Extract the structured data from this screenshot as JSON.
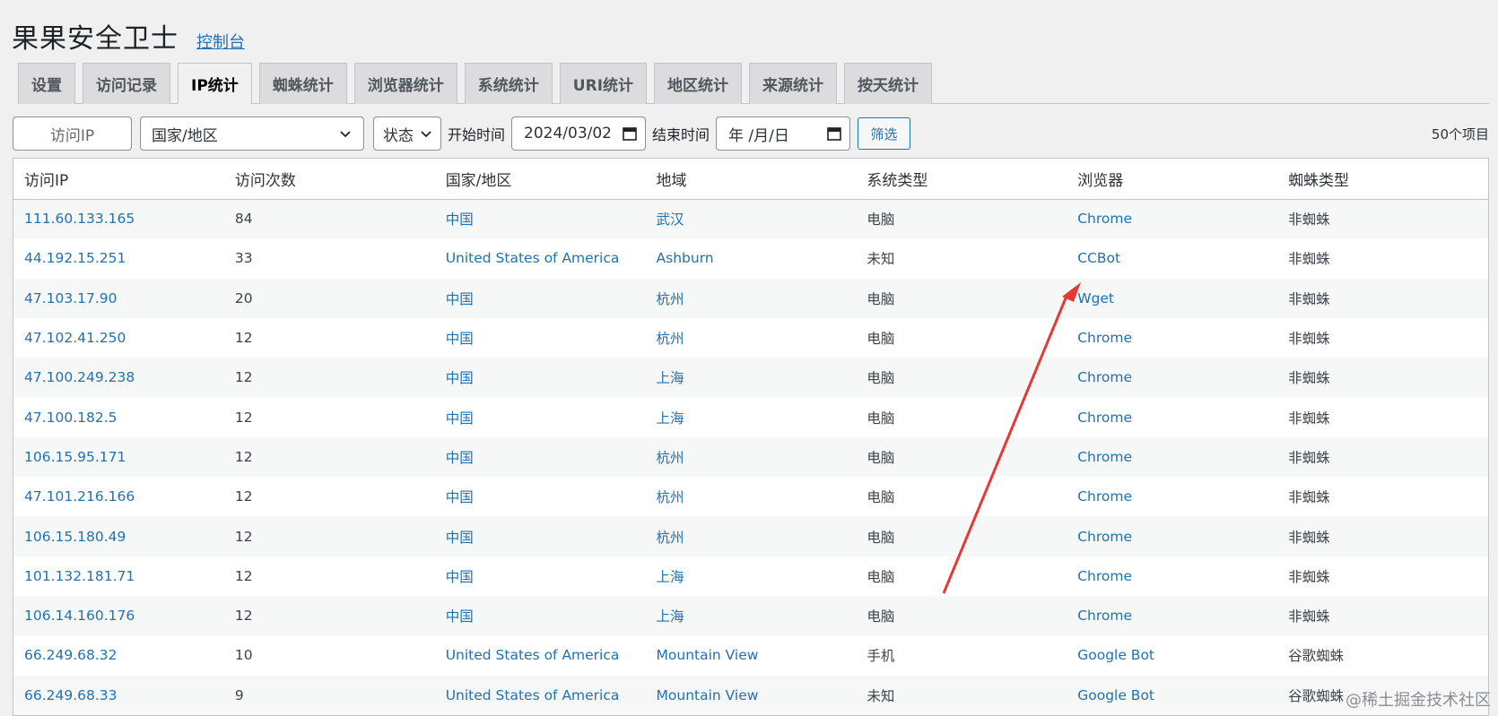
{
  "app": {
    "title": "果果安全卫士",
    "console_link": "控制台"
  },
  "tabs": [
    {
      "label": "设置",
      "active": false
    },
    {
      "label": "访问记录",
      "active": false
    },
    {
      "label": "IP统计",
      "active": true
    },
    {
      "label": "蜘蛛统计",
      "active": false
    },
    {
      "label": "浏览器统计",
      "active": false
    },
    {
      "label": "系统统计",
      "active": false
    },
    {
      "label": "URI统计",
      "active": false
    },
    {
      "label": "地区统计",
      "active": false
    },
    {
      "label": "来源统计",
      "active": false
    },
    {
      "label": "按天统计",
      "active": false
    }
  ],
  "filters": {
    "ip_placeholder": "访问IP",
    "country_value": "国家/地区",
    "status_value": "状态",
    "start_label": "开始时间",
    "start_value": "2024/03/02",
    "end_label": "结束时间",
    "end_value": "年 /月/日",
    "filter_button": "筛选",
    "item_count": "50个项目"
  },
  "table": {
    "headers": [
      "访问IP",
      "访问次数",
      "国家/地区",
      "地域",
      "系统类型",
      "浏览器",
      "蜘蛛类型"
    ],
    "rows": [
      [
        "111.60.133.165",
        "84",
        "中国",
        "武汉",
        "电脑",
        "Chrome",
        "非蜘蛛"
      ],
      [
        "44.192.15.251",
        "33",
        "United States of America",
        "Ashburn",
        "未知",
        "CCBot",
        "非蜘蛛"
      ],
      [
        "47.103.17.90",
        "20",
        "中国",
        "杭州",
        "电脑",
        "Wget",
        "非蜘蛛"
      ],
      [
        "47.102.41.250",
        "12",
        "中国",
        "杭州",
        "电脑",
        "Chrome",
        "非蜘蛛"
      ],
      [
        "47.100.249.238",
        "12",
        "中国",
        "上海",
        "电脑",
        "Chrome",
        "非蜘蛛"
      ],
      [
        "47.100.182.5",
        "12",
        "中国",
        "上海",
        "电脑",
        "Chrome",
        "非蜘蛛"
      ],
      [
        "106.15.95.171",
        "12",
        "中国",
        "杭州",
        "电脑",
        "Chrome",
        "非蜘蛛"
      ],
      [
        "47.101.216.166",
        "12",
        "中国",
        "杭州",
        "电脑",
        "Chrome",
        "非蜘蛛"
      ],
      [
        "106.15.180.49",
        "12",
        "中国",
        "杭州",
        "电脑",
        "Chrome",
        "非蜘蛛"
      ],
      [
        "101.132.181.71",
        "12",
        "中国",
        "上海",
        "电脑",
        "Chrome",
        "非蜘蛛"
      ],
      [
        "106.14.160.176",
        "12",
        "中国",
        "上海",
        "电脑",
        "Chrome",
        "非蜘蛛"
      ],
      [
        "66.249.68.32",
        "10",
        "United States of America",
        "Mountain View",
        "手机",
        "Google Bot",
        "谷歌蜘蛛"
      ],
      [
        "66.249.68.33",
        "9",
        "United States of America",
        "Mountain View",
        "未知",
        "Google Bot",
        "谷歌蜘蛛"
      ]
    ]
  },
  "annotation": {
    "arrow_color": "#e53935"
  },
  "watermark": "@稀土掘金技术社区",
  "colors": {
    "link": "#2271b1",
    "background": "#f0f0f1"
  }
}
